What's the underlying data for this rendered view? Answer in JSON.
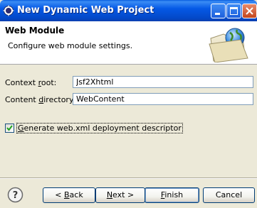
{
  "window": {
    "title": "New Dynamic Web Project",
    "controls": {
      "minimize": "minimize-icon",
      "maximize": "maximize-icon",
      "close": "close-icon"
    }
  },
  "banner": {
    "title": "Web Module",
    "description": "Configure web module settings.",
    "icon": "web-folder-globe-icon"
  },
  "form": {
    "context_root": {
      "label_pre": "Context ",
      "label_mnemonic": "r",
      "label_post": "oot:",
      "value": "Jsf2Xhtml"
    },
    "content_directory": {
      "label_pre": "Content ",
      "label_mnemonic": "d",
      "label_post": "irectory:",
      "value": "WebContent"
    },
    "generate_descriptor": {
      "label_pre": "",
      "label_mnemonic": "G",
      "label_post": "enerate web.xml deployment descriptor",
      "checked": true
    }
  },
  "buttons": {
    "help": "help-icon",
    "back": {
      "pre": "< ",
      "mnemonic": "B",
      "post": "ack"
    },
    "next": {
      "pre": "",
      "mnemonic": "N",
      "post": "ext >"
    },
    "finish": {
      "pre": "",
      "mnemonic": "F",
      "post": "inish"
    },
    "cancel": {
      "label": "Cancel"
    }
  }
}
